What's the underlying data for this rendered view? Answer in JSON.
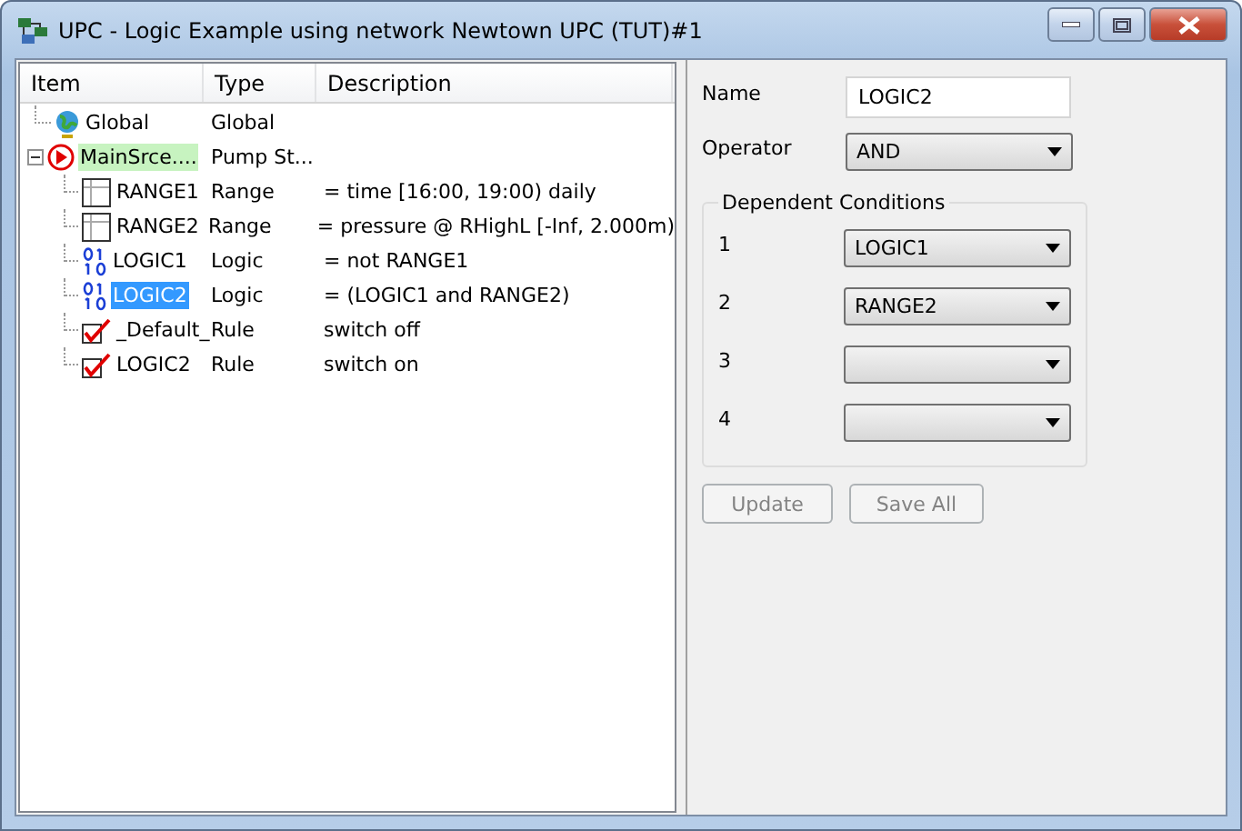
{
  "window": {
    "title": "UPC - Logic Example using network Newtown UPC (TUT)#1"
  },
  "tree": {
    "columns": [
      "Item",
      "Type",
      "Description"
    ],
    "items": [
      {
        "kind": "global",
        "label": "Global",
        "type": "Global",
        "selected": false,
        "highlighted": false
      },
      {
        "kind": "station",
        "label": "MainSrce....",
        "type": "Pump St...",
        "selected": false,
        "highlighted": true,
        "expanded": true,
        "children": [
          {
            "kind": "range",
            "label": "RANGE1",
            "type": "Range",
            "description": "= time [16:00, 19:00) daily",
            "selected": false,
            "highlighted": false
          },
          {
            "kind": "range",
            "label": "RANGE2",
            "type": "Range",
            "description": "= pressure @ RHighL [-Inf, 2.000m)",
            "selected": false,
            "highlighted": false
          },
          {
            "kind": "logic",
            "label": "LOGIC1",
            "type": "Logic",
            "description": "= not RANGE1",
            "selected": false,
            "highlighted": false
          },
          {
            "kind": "logic",
            "label": "LOGIC2",
            "type": "Logic",
            "description": "= (LOGIC1 and RANGE2)",
            "selected": true,
            "highlighted": false
          },
          {
            "kind": "rule",
            "label": "_Default_",
            "type": "Rule",
            "description": "switch off",
            "selected": false,
            "highlighted": false
          },
          {
            "kind": "rule",
            "label": "LOGIC2",
            "type": "Rule",
            "description": "switch on",
            "selected": false,
            "highlighted": false
          }
        ]
      }
    ]
  },
  "form": {
    "name": {
      "label": "Name",
      "value": "LOGIC2"
    },
    "operator": {
      "label": "Operator",
      "value": "AND"
    },
    "conditions": {
      "title": "Dependent Conditions",
      "rows": [
        {
          "label": "1",
          "value": "LOGIC1"
        },
        {
          "label": "2",
          "value": "RANGE2"
        },
        {
          "label": "3"
        },
        {
          "label": "4"
        }
      ]
    },
    "buttons": [
      {
        "label": "Update",
        "disabled": true
      },
      {
        "label": "Save All",
        "disabled": true
      }
    ]
  }
}
